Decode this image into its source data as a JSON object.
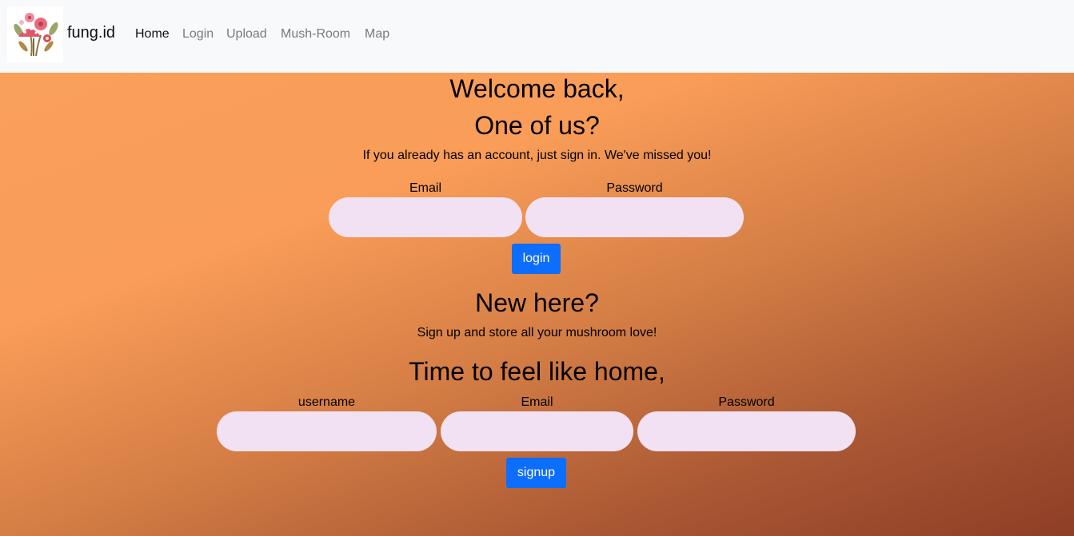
{
  "nav": {
    "brand": "fung.id",
    "logo_icon": "mushroom-bouquet-logo",
    "links": [
      "Home",
      "Login",
      "Upload",
      "Mush-Room",
      "Map"
    ],
    "active_link": "Home"
  },
  "login": {
    "heading1": "Welcome back,",
    "heading2": "One of us?",
    "subtitle": "If you already has an account, just sign in. We've missed you!",
    "email_label": "Email",
    "password_label": "Password",
    "email_value": "",
    "password_value": "",
    "button": "login"
  },
  "signup": {
    "heading1": "New here?",
    "subtitle": "Sign up and store all your mushroom love!",
    "heading2": "Time to feel like home,",
    "username_label": "username",
    "email_label": "Email",
    "password_label": "Password",
    "username_value": "",
    "email_value": "",
    "password_value": "",
    "button": "signup"
  },
  "colors": {
    "navbar_bg": "#f8f9fa",
    "gradient_start": "#f9a05a",
    "gradient_end": "#8e3e26",
    "input_bg": "#f1e1f2",
    "button_bg": "#0d6efd"
  }
}
